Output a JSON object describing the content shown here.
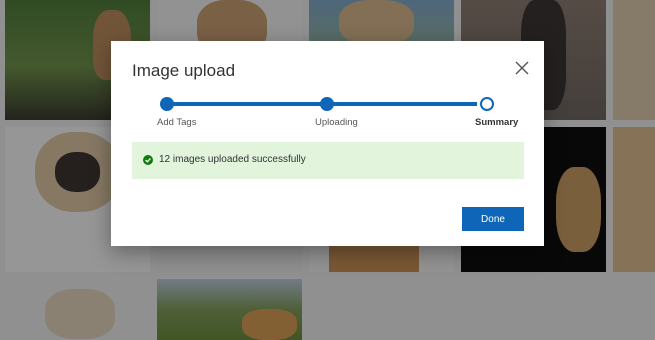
{
  "modal": {
    "title": "Image upload",
    "done_label": "Done"
  },
  "stepper": {
    "steps": [
      {
        "label": "Add Tags",
        "state": "complete"
      },
      {
        "label": "Uploading",
        "state": "complete"
      },
      {
        "label": "Summary",
        "state": "current"
      }
    ]
  },
  "status": {
    "message": "12 images uploaded successfully",
    "icon": "check-circle-icon"
  },
  "colors": {
    "accent": "#0f66b8",
    "success_bg": "#e3f4dd",
    "success_icon": "#107c10"
  }
}
